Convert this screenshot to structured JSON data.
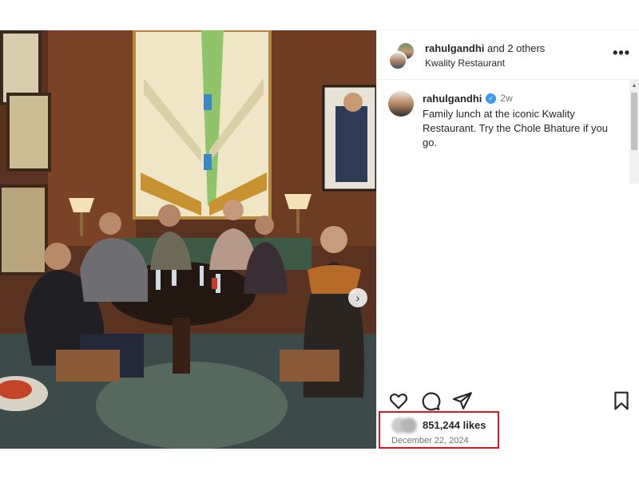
{
  "post": {
    "header": {
      "username": "rahulgandhi",
      "collab_text": "and 2 others",
      "location": "Kwality Restaurant",
      "more_icon": "more-horizontal-icon"
    },
    "caption": {
      "username": "rahulgandhi",
      "verified": true,
      "time_ago": "2w",
      "text": "Family lunch at the iconic Kwality Restaurant. Try the Chole Bhature if you go."
    },
    "actions": {
      "like_icon": "heart-icon",
      "comment_icon": "comment-icon",
      "share_icon": "share-icon",
      "save_icon": "bookmark-icon"
    },
    "likes": "851,244 likes",
    "date": "December 22, 2024"
  },
  "colors": {
    "highlight_box": "#e0151f",
    "verified_badge": "#3897f0",
    "secondary_text": "#737373"
  }
}
